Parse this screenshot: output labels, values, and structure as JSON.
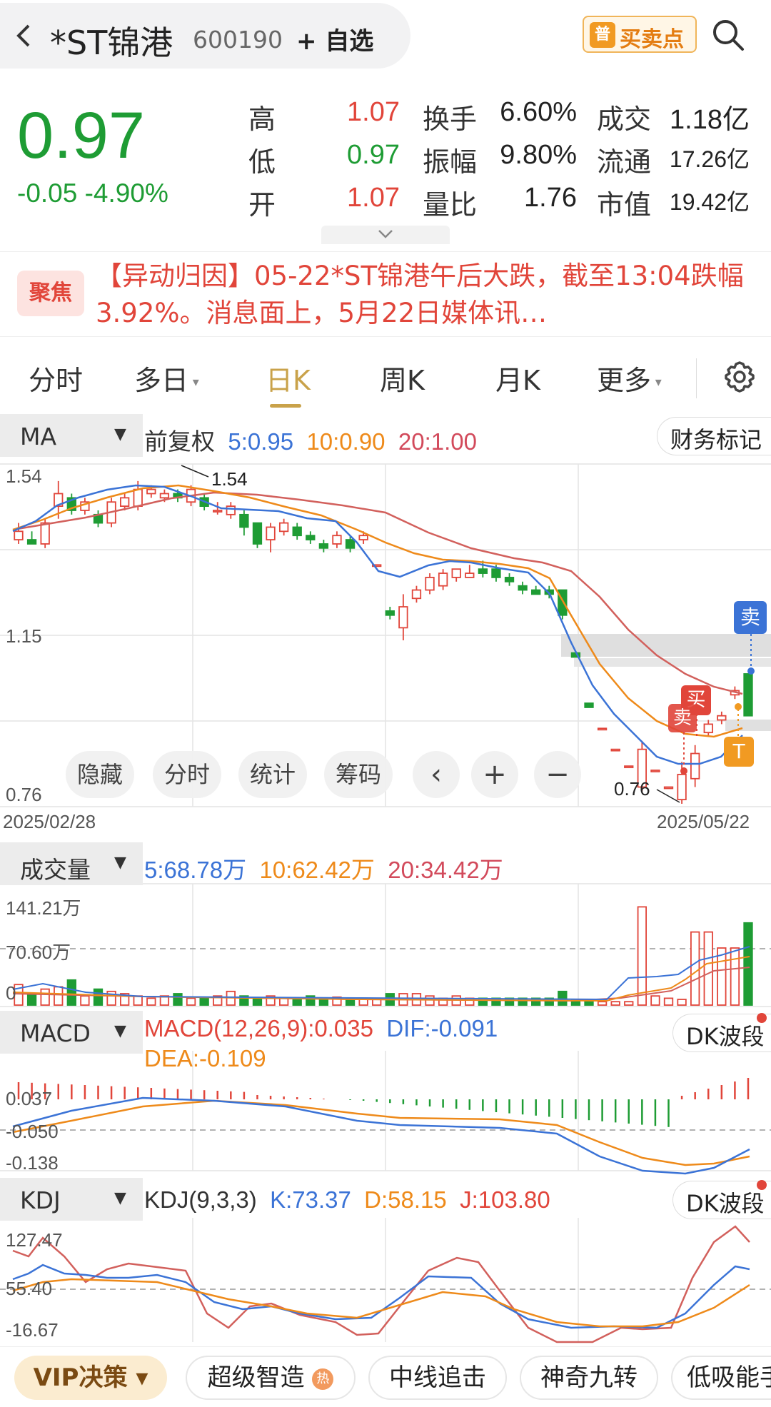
{
  "header": {
    "stock_name": "*ST锦港",
    "stock_code": "600190",
    "watch_label": "+ 自选",
    "bs_icon": "普",
    "bs_label": "买卖点"
  },
  "quote": {
    "price": "0.97",
    "change": "-0.05 -4.90%",
    "rows": [
      {
        "l1": "高",
        "v1": "1.07",
        "l2": "换手",
        "v2": "6.60%",
        "l3": "成交",
        "v3": "1.18亿"
      },
      {
        "l1": "低",
        "v1": "0.97",
        "l2": "振幅",
        "v2": "9.80%",
        "l3": "流通",
        "v3": "17.26亿"
      },
      {
        "l1": "开",
        "v1": "1.07",
        "l2": "量比",
        "v2": "1.76",
        "l3": "市值",
        "v3": "19.42亿"
      }
    ]
  },
  "news": {
    "badge": "聚焦",
    "text": "【异动归因】05-22*ST锦港午后大跌，截至13:04跌幅3.92%。消息面上，5月22日媒体讯…"
  },
  "tabs": [
    "分时",
    "多日",
    "日K",
    "周K",
    "月K",
    "更多"
  ],
  "active_tab": "日K",
  "ma_bar": {
    "name": "MA",
    "mode": "前复权",
    "ma5": "5:0.95",
    "ma10": "10:0.90",
    "ma20": "20:1.00",
    "btn": "财务标记"
  },
  "kline": {
    "y_top": "1.54",
    "y_mid": "1.15",
    "y_bottom": "0.76",
    "max_label": "1.54",
    "min_label": "0.76",
    "date_start": "2025/02/28",
    "date_end": "2025/05/22",
    "buy": "买",
    "sell": "卖",
    "t": "T",
    "tools": [
      "隐藏",
      "分时",
      "统计",
      "筹码"
    ]
  },
  "vol_bar": {
    "name": "成交量",
    "ma5": "5:68.78万",
    "ma10": "10:62.42万",
    "ma20": "20:34.42万",
    "y_top": "141.21万",
    "y_mid": "70.60万",
    "y_zero": "0"
  },
  "macd_bar": {
    "name": "MACD",
    "macd": "MACD(12,26,9):0.035",
    "dif": "DIF:-0.091",
    "dea": "DEA:-0.109",
    "btn": "DK波段",
    "y1": "0.037",
    "y2": "-0.050",
    "y3": "-0.138"
  },
  "kdj_bar": {
    "name": "KDJ",
    "params": "KDJ(9,3,3)",
    "k": "K:73.37",
    "d": "D:58.15",
    "j": "J:103.80",
    "btn": "DK波段",
    "y1": "127.47",
    "y2": "55.40",
    "y3": "-16.67"
  },
  "bottom": {
    "vip": "VIP决策",
    "chips": [
      "超级智造",
      "中线追击",
      "神奇九转",
      "低吸能手"
    ],
    "hot": "热"
  },
  "chart_data": {
    "type": "candlestick",
    "date_range": [
      "2025/02/28",
      "2025/05/22"
    ],
    "price_axis": [
      1.54,
      1.15,
      0.76
    ],
    "candles": [
      [
        1.39,
        1.41,
        1.43,
        1.38
      ],
      [
        1.39,
        1.38,
        1.41,
        1.38
      ],
      [
        1.38,
        1.43,
        1.44,
        1.37
      ],
      [
        1.47,
        1.5,
        1.53,
        1.44
      ],
      [
        1.49,
        1.46,
        1.5,
        1.45
      ],
      [
        1.46,
        1.48,
        1.49,
        1.45
      ],
      [
        1.45,
        1.43,
        1.46,
        1.42
      ],
      [
        1.43,
        1.48,
        1.49,
        1.42
      ],
      [
        1.47,
        1.49,
        1.5,
        1.46
      ],
      [
        1.47,
        1.51,
        1.53,
        1.46
      ],
      [
        1.5,
        1.51,
        1.52,
        1.49
      ],
      [
        1.49,
        1.5,
        1.51,
        1.48
      ],
      [
        1.5,
        1.49,
        1.51,
        1.48
      ],
      [
        1.48,
        1.51,
        1.52,
        1.47
      ],
      [
        1.49,
        1.47,
        1.5,
        1.46
      ],
      [
        1.46,
        1.46,
        1.48,
        1.45
      ],
      [
        1.45,
        1.47,
        1.48,
        1.44
      ],
      [
        1.45,
        1.42,
        1.46,
        1.4
      ],
      [
        1.43,
        1.38,
        1.43,
        1.37
      ],
      [
        1.39,
        1.42,
        1.43,
        1.36
      ],
      [
        1.41,
        1.43,
        1.44,
        1.4
      ],
      [
        1.42,
        1.4,
        1.43,
        1.39
      ],
      [
        1.4,
        1.39,
        1.41,
        1.38
      ],
      [
        1.38,
        1.37,
        1.39,
        1.36
      ],
      [
        1.38,
        1.4,
        1.41,
        1.37
      ],
      [
        1.39,
        1.37,
        1.4,
        1.36
      ],
      [
        1.39,
        1.4,
        1.41,
        1.38
      ],
      [
        1.33,
        1.33,
        1.33,
        1.33
      ],
      [
        1.22,
        1.21,
        1.23,
        1.2
      ],
      [
        1.18,
        1.23,
        1.26,
        1.15
      ],
      [
        1.25,
        1.27,
        1.28,
        1.24
      ],
      [
        1.27,
        1.3,
        1.31,
        1.26
      ],
      [
        1.28,
        1.31,
        1.32,
        1.27
      ],
      [
        1.3,
        1.32,
        1.32,
        1.29
      ],
      [
        1.3,
        1.31,
        1.33,
        1.3
      ],
      [
        1.32,
        1.31,
        1.34,
        1.3
      ],
      [
        1.32,
        1.3,
        1.33,
        1.29
      ],
      [
        1.3,
        1.29,
        1.31,
        1.28
      ],
      [
        1.28,
        1.27,
        1.29,
        1.26
      ],
      [
        1.27,
        1.26,
        1.28,
        1.26
      ],
      [
        1.27,
        1.26,
        1.28,
        1.25
      ],
      [
        1.27,
        1.21,
        1.27,
        1.2
      ],
      [
        1.12,
        1.11,
        1.12,
        1.11
      ],
      [
        1.0,
        0.99,
        1.0,
        0.99
      ],
      [
        0.94,
        0.94,
        0.94,
        0.94
      ],
      [
        0.89,
        0.89,
        0.89,
        0.89
      ],
      [
        0.85,
        0.85,
        0.85,
        0.85
      ],
      [
        0.8,
        0.89,
        0.91,
        0.79
      ],
      [
        0.84,
        0.84,
        0.84,
        0.84
      ],
      [
        0.8,
        0.8,
        0.8,
        0.8
      ],
      [
        0.77,
        0.83,
        0.86,
        0.76
      ],
      [
        0.82,
        0.88,
        0.9,
        0.8
      ],
      [
        0.93,
        0.95,
        0.96,
        0.92
      ],
      [
        0.96,
        0.97,
        0.98,
        0.95
      ],
      [
        1.02,
        1.03,
        1.04,
        1.01
      ],
      [
        1.07,
        0.97,
        1.07,
        0.97
      ]
    ],
    "volume_axis": [
      "141.21万",
      "70.60万",
      "0"
    ],
    "macd_axis": [
      0.037,
      -0.05,
      -0.138
    ],
    "kdj_axis": [
      127.47,
      55.4,
      -16.67
    ]
  }
}
